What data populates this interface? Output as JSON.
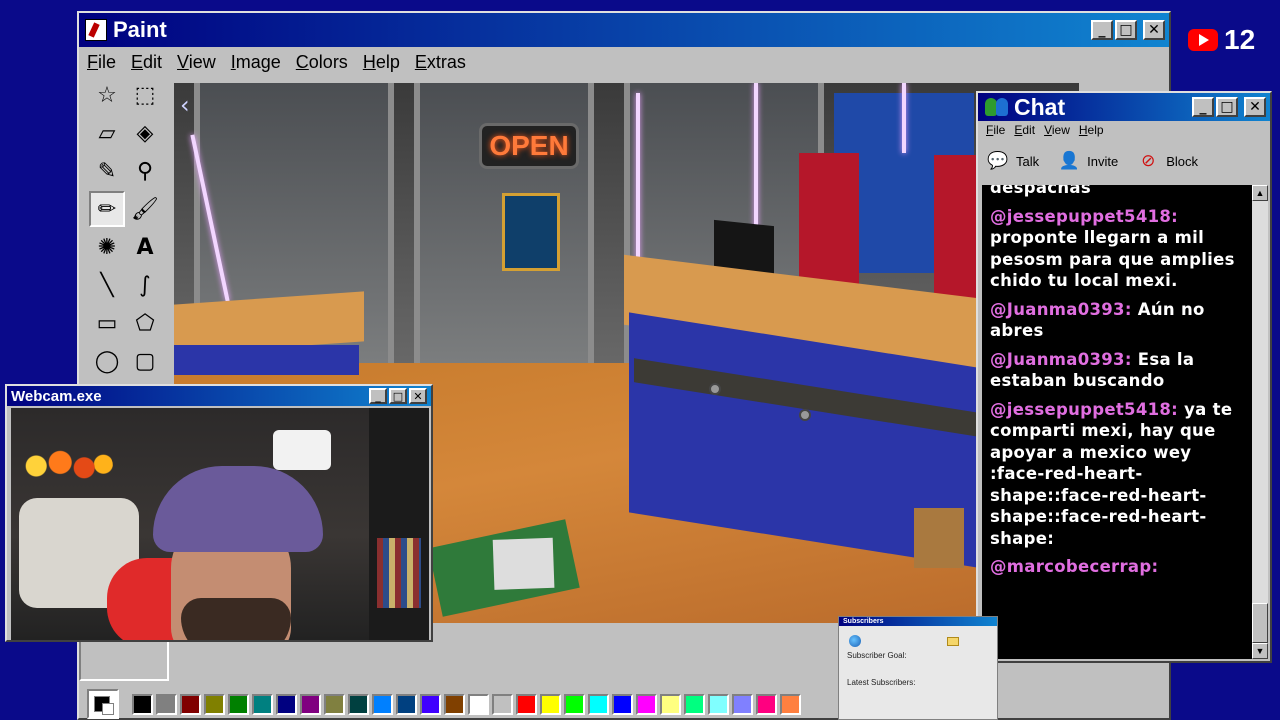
{
  "paint": {
    "title": "Paint",
    "menu": [
      "File",
      "Edit",
      "View",
      "Image",
      "Colors",
      "Help",
      "Extras"
    ],
    "tools": [
      "free-select",
      "rect-select",
      "eraser",
      "fill",
      "color-picker",
      "magnifier",
      "pencil",
      "brush",
      "airbrush",
      "text",
      "line",
      "curve",
      "rectangle",
      "polygon",
      "ellipse",
      "rounded-rectangle"
    ],
    "active_tool": "pencil",
    "canvas": {
      "open_sign": "OPEN"
    },
    "palette": [
      "#000000",
      "#808080",
      "#800000",
      "#808000",
      "#008000",
      "#008080",
      "#000080",
      "#800080",
      "#808040",
      "#004040",
      "#0080ff",
      "#004080",
      "#4000ff",
      "#804000",
      "#ffffff",
      "#c0c0c0",
      "#ff0000",
      "#ffff00",
      "#00ff00",
      "#00ffff",
      "#0000ff",
      "#ff00ff",
      "#ffff80",
      "#00ff80",
      "#80ffff",
      "#8080ff",
      "#ff0080",
      "#ff8040"
    ]
  },
  "youtube": {
    "count": "12"
  },
  "chat": {
    "title": "Chat",
    "menu": [
      "File",
      "Edit",
      "View",
      "Help"
    ],
    "toolbar": [
      {
        "label": "Talk",
        "icon": "talk-icon"
      },
      {
        "label": "Invite",
        "icon": "invite-icon"
      },
      {
        "label": "Block",
        "icon": "block-icon"
      }
    ],
    "messages": [
      {
        "user": "",
        "text": "despachas"
      },
      {
        "user": "@jessepuppet5418:",
        "text": "proponte llegarn a mil pesosm para que amplies chido tu local mexi."
      },
      {
        "user": "@Juanma0393:",
        "text": "Aún no abres"
      },
      {
        "user": "@Juanma0393:",
        "text": "Esa la estaban buscando"
      },
      {
        "user": "@jessepuppet5418:",
        "text": "ya te comparti mexi, hay que apoyar a mexico wey :face-red-heart-shape::face-red-heart-shape::face-red-heart-shape:"
      },
      {
        "user": "@marcobecerrap:",
        "text": ""
      }
    ]
  },
  "webcam": {
    "title": "Webcam.exe"
  },
  "subscribers": {
    "title": "Subscribers",
    "goal_label": "Subscriber Goal:",
    "latest_label": "Latest Subscribers:"
  }
}
